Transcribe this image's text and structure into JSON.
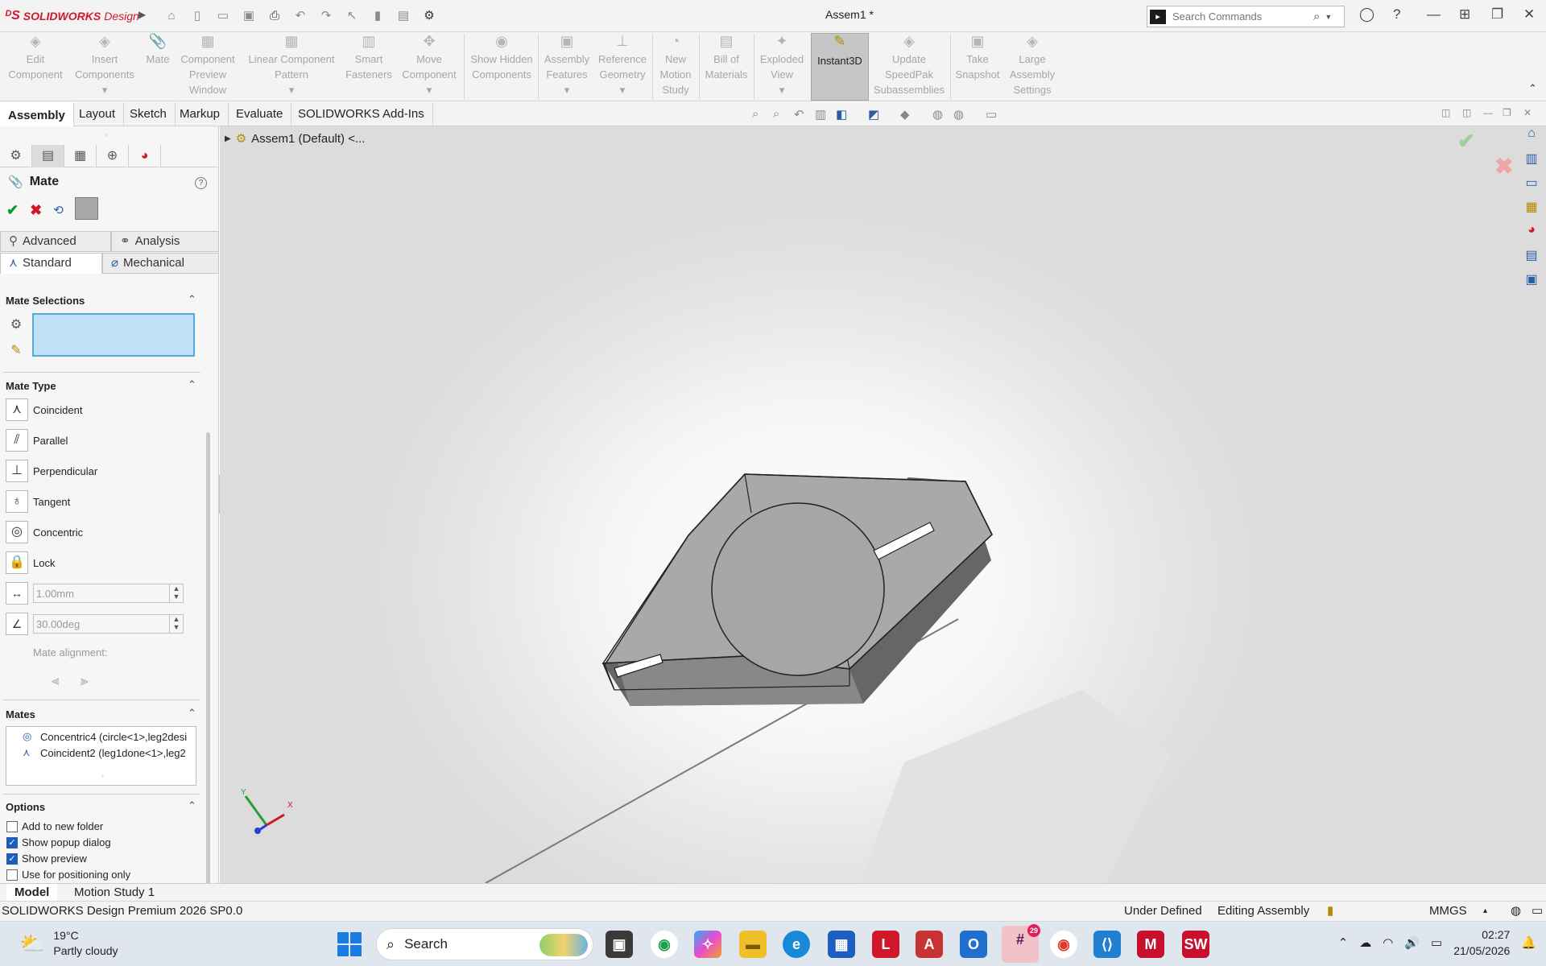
{
  "app": {
    "logo_brand": "SOLIDWORKS",
    "logo_edition": "Design",
    "document_title": "Assem1 *",
    "search_placeholder": "Search Commands"
  },
  "ribbon": {
    "buttons": [
      {
        "label": "Edit Component"
      },
      {
        "label": "Insert Components"
      },
      {
        "label": "Mate"
      },
      {
        "label": "Component Preview Window"
      },
      {
        "label": "Linear Component Pattern"
      },
      {
        "label": "Smart Fasteners"
      },
      {
        "label": "Move Component"
      },
      {
        "label": "Show Hidden Components"
      },
      {
        "label": "Assembly Features"
      },
      {
        "label": "Reference Geometry"
      },
      {
        "label": "New Motion Study"
      },
      {
        "label": "Bill of Materials"
      },
      {
        "label": "Exploded View"
      },
      {
        "label": "Instant3D"
      },
      {
        "label": "Update SpeedPak Subassemblies"
      },
      {
        "label": "Take Snapshot"
      },
      {
        "label": "Large Assembly Settings"
      }
    ]
  },
  "command_tabs": [
    "Assembly",
    "Layout",
    "Sketch",
    "Markup",
    "Evaluate",
    "SOLIDWORKS Add-Ins"
  ],
  "tree": {
    "root_label": "Assem1 (Default) <..."
  },
  "property_manager": {
    "title": "Mate",
    "subtabs": {
      "advanced": "Advanced",
      "analysis": "Analysis",
      "standard": "Standard",
      "mechanical": "Mechanical"
    },
    "sections": {
      "mate_selections": "Mate Selections",
      "mate_type": "Mate Type",
      "mates": "Mates",
      "options": "Options"
    },
    "mate_types": [
      "Coincident",
      "Parallel",
      "Perpendicular",
      "Tangent",
      "Concentric",
      "Lock"
    ],
    "distance_value": "1.00mm",
    "angle_value": "30.00deg",
    "mate_alignment_label": "Mate alignment:",
    "mates_list": [
      {
        "icon": "concentric-icon",
        "label": "Concentric4 (circle<1>,leg2desi"
      },
      {
        "icon": "coincident-icon",
        "label": "Coincident2 (leg1done<1>,leg2"
      }
    ],
    "options": [
      {
        "label": "Add to new folder",
        "checked": false
      },
      {
        "label": "Show popup dialog",
        "checked": true
      },
      {
        "label": "Show preview",
        "checked": true
      },
      {
        "label": "Use for positioning only",
        "checked": false
      }
    ]
  },
  "triad": {
    "x": "X",
    "y": "Y"
  },
  "bottom_tabs": [
    "Model",
    "Motion Study 1"
  ],
  "status_bar": {
    "product": "SOLIDWORKS Design Premium 2026 SP0.0",
    "state": "Under Defined",
    "mode": "Editing Assembly",
    "units": "MMGS"
  },
  "taskbar": {
    "temperature": "19°C",
    "weather": "Partly cloudy",
    "search_label": "Search",
    "time": "02:27",
    "date": "21/05/2026",
    "slack_badge": "29"
  }
}
